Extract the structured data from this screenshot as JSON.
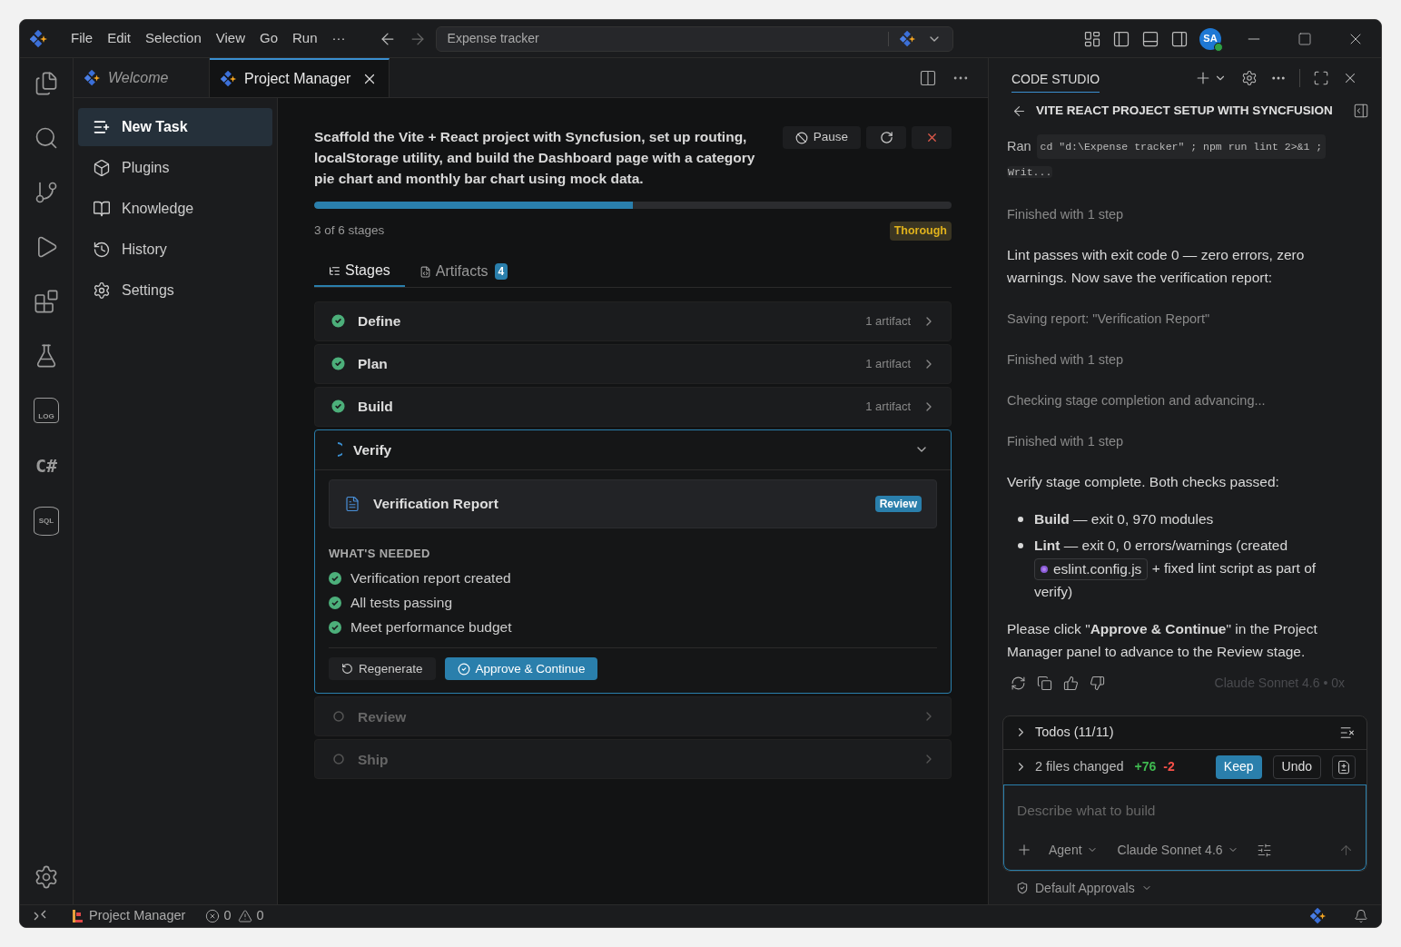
{
  "title_bar": {
    "menu": [
      "File",
      "Edit",
      "Selection",
      "View",
      "Go",
      "Run",
      "···"
    ],
    "command_center": "Expense tracker",
    "avatar": "SA"
  },
  "activity_bar": [
    {
      "kind": "files"
    },
    {
      "kind": "search"
    },
    {
      "kind": "source-control"
    },
    {
      "kind": "run"
    },
    {
      "kind": "extensions"
    },
    {
      "kind": "testing"
    },
    {
      "kind": "log",
      "label": "LOG"
    },
    {
      "kind": "text",
      "label": "C#"
    },
    {
      "kind": "database",
      "label": "SQL"
    }
  ],
  "editor_tabs": [
    {
      "label": "Welcome",
      "preview": true,
      "selected": false
    },
    {
      "label": "Project Manager",
      "preview": false,
      "selected": true
    }
  ],
  "nav": [
    {
      "label": "New Task",
      "kind": "new-task",
      "selected": true
    },
    {
      "label": "Plugins",
      "kind": "plugins",
      "selected": false
    },
    {
      "label": "Knowledge",
      "kind": "knowledge",
      "selected": false
    },
    {
      "label": "History",
      "kind": "history",
      "selected": false
    },
    {
      "label": "Settings",
      "kind": "settings",
      "selected": false
    }
  ],
  "task": {
    "description": "Scaffold the Vite + React project with Syncfusion, set up routing, localStorage utility, and build the Dashboard page with a category pie chart and monthly bar chart using mock data.",
    "pause": "Pause",
    "level": 0.5,
    "progress_text": "3 of 6 stages",
    "mode": "Thorough"
  },
  "tabs": [
    {
      "label": "Stages",
      "selected": true
    },
    {
      "label": "Artifacts",
      "badge": "4",
      "selected": false
    }
  ],
  "stages": [
    {
      "name": "Define",
      "kind": "done",
      "meta": "1 artifact",
      "expanded": false
    },
    {
      "name": "Plan",
      "kind": "done",
      "meta": "1 artifact",
      "expanded": false
    },
    {
      "name": "Build",
      "kind": "done",
      "meta": "1 artifact",
      "expanded": false
    },
    {
      "name": "Verify",
      "kind": "active",
      "expanded": true,
      "artifact": {
        "title": "Verification Report",
        "badge": "Review"
      },
      "needed_title": "WHAT'S NEEDED",
      "needed": [
        {
          "text": "Verification report created",
          "checked": true
        },
        {
          "text": "All tests passing",
          "checked": true
        },
        {
          "text": "Meet performance budget",
          "checked": true
        }
      ],
      "regenerate": "Regenerate",
      "approve": "Approve & Continue"
    },
    {
      "name": "Review",
      "kind": "pending",
      "expanded": false
    },
    {
      "name": "Ship",
      "kind": "pending",
      "expanded": false
    }
  ],
  "code_studio": {
    "header": "CODE STUDIO",
    "thread_title": "VITE REACT PROJECT SETUP WITH SYNCFUSION",
    "messages": [
      {
        "kind": "command",
        "prefix": "Ran",
        "code_lines": [
          "cd \"d:\\Expense tracker\" ; npm run lint 2>&1 ;",
          "Writ..."
        ]
      },
      {
        "kind": "status",
        "text": "Finished with 1 step"
      },
      {
        "kind": "paragraph",
        "text": "Lint passes with exit code 0 — zero errors, zero warnings. Now save the verification report:"
      },
      {
        "kind": "status",
        "text": "Saving report: \"Verification Report\""
      },
      {
        "kind": "status",
        "text": "Finished with 1 step"
      },
      {
        "kind": "status",
        "text": "Checking stage completion and advancing..."
      },
      {
        "kind": "status",
        "text": "Finished with 1 step"
      },
      {
        "kind": "paragraph",
        "text": "Verify stage complete. Both checks passed:"
      },
      {
        "kind": "bullets",
        "items": [
          {
            "text": "**Build** — exit 0, 970 modules"
          },
          {
            "text": "**Lint** — exit 0, 0 errors/warnings (created",
            "file": "eslint.config.js",
            "after": "+ fixed lint script as part of verify)"
          }
        ]
      },
      {
        "kind": "paragraph",
        "text": "Please click \"**Approve & Continue**\" in the Project Manager panel to advance to the Review stage."
      }
    ],
    "model_hint": "Claude Sonnet 4.6 • 0x",
    "todos": "Todos (11/11)",
    "changes": {
      "text": "2 files changed",
      "added": "+76",
      "removed": "-2",
      "keep": "Keep",
      "undo": "Undo"
    },
    "input": {
      "placeholder": "Describe what to build"
    },
    "mode": "Agent",
    "model": "Claude Sonnet 4.6",
    "approvals": "Default Approvals"
  },
  "status_bar": {
    "item": "Project Manager",
    "errors": "0",
    "warnings": "0"
  }
}
